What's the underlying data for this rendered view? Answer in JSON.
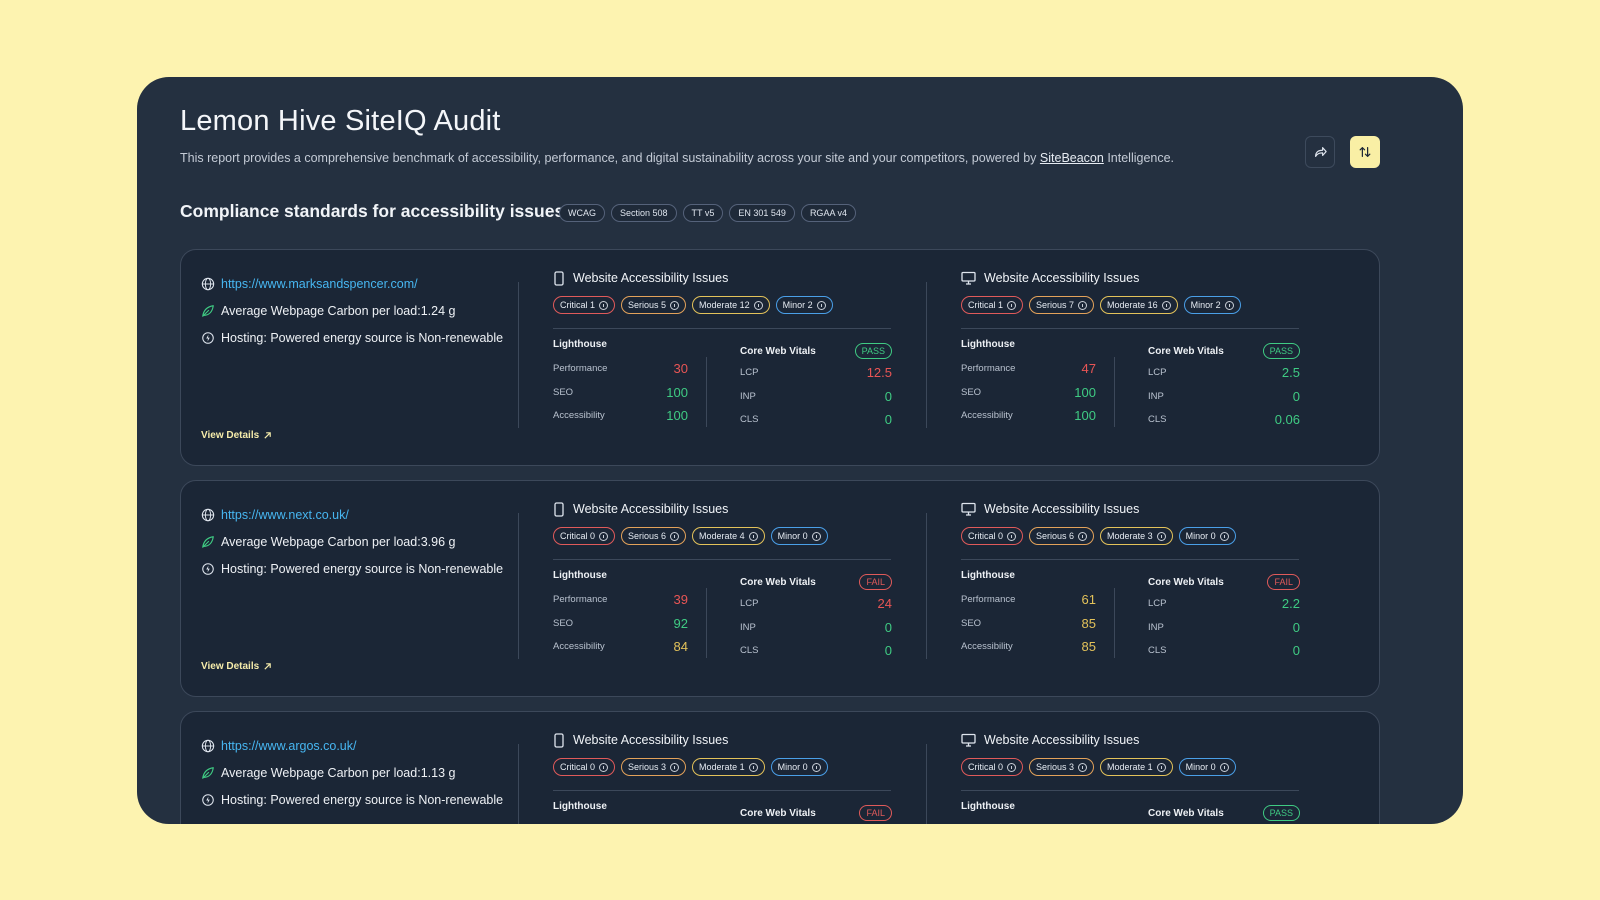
{
  "header": {
    "title": "Lemon Hive SiteIQ Audit",
    "subtitle_pre": "This report provides a comprehensive benchmark of accessibility, performance, and digital sustainability across your site and your competitors, powered by ",
    "subtitle_link": "SiteBeacon",
    "subtitle_post": " Intelligence."
  },
  "standards": {
    "title": "Compliance standards for accessibility issues",
    "tags": [
      "WCAG",
      "Section 508",
      "TT v5",
      "EN 301 549",
      "RGAA v4"
    ]
  },
  "labels": {
    "carbon_prefix": "Average Webpage Carbon per load: ",
    "hosting": "Hosting: Powered energy source is Non-renewable",
    "view_details": "View Details",
    "issues_title": "Website Accessibility Issues",
    "lighthouse": "Lighthouse",
    "core_web_vitals": "Core Web Vitals",
    "performance": "Performance",
    "seo": "SEO",
    "accessibility": "Accessibility",
    "lcp": "LCP",
    "inp": "INP",
    "cls": "CLS"
  },
  "sites": [
    {
      "url": "https://www.marksandspencer.com/",
      "carbon": "1.24 g",
      "mobile": {
        "issues": {
          "critical": "Critical 1",
          "serious": "Serious 5",
          "moderate": "Moderate 12",
          "minor": "Minor 2"
        },
        "performance": "30",
        "seo": "100",
        "accessibility": "100",
        "status": "PASS",
        "lcp": "12.5",
        "inp": "0",
        "cls": "0"
      },
      "desktop": {
        "issues": {
          "critical": "Critical 1",
          "serious": "Serious 7",
          "moderate": "Moderate 16",
          "minor": "Minor 2"
        },
        "performance": "47",
        "seo": "100",
        "accessibility": "100",
        "status": "PASS",
        "lcp": "2.5",
        "inp": "0",
        "cls": "0.06"
      }
    },
    {
      "url": "https://www.next.co.uk/",
      "carbon": "3.96 g",
      "mobile": {
        "issues": {
          "critical": "Critical 0",
          "serious": "Serious 6",
          "moderate": "Moderate 4",
          "minor": "Minor 0"
        },
        "performance": "39",
        "seo": "92",
        "accessibility": "84",
        "status": "FAIL",
        "lcp": "24",
        "inp": "0",
        "cls": "0"
      },
      "desktop": {
        "issues": {
          "critical": "Critical 0",
          "serious": "Serious 6",
          "moderate": "Moderate 3",
          "minor": "Minor 0"
        },
        "performance": "61",
        "seo": "85",
        "accessibility": "85",
        "status": "FAIL",
        "lcp": "2.2",
        "inp": "0",
        "cls": "0"
      }
    },
    {
      "url": "https://www.argos.co.uk/",
      "carbon": "1.13 g",
      "mobile": {
        "issues": {
          "critical": "Critical 0",
          "serious": "Serious 3",
          "moderate": "Moderate 1",
          "minor": "Minor 0"
        },
        "status": "FAIL"
      },
      "desktop": {
        "issues": {
          "critical": "Critical 0",
          "serious": "Serious 3",
          "moderate": "Moderate 1",
          "minor": "Minor 0"
        },
        "status": "PASS"
      }
    }
  ],
  "colors": {
    "background": "#fdf3b0",
    "panel": "#243040",
    "card": "#1b2636",
    "accent": "#f9efa5",
    "link": "#47b6f1",
    "good": "#3fcb83",
    "average": "#e3c25a",
    "poor": "#e85555"
  }
}
